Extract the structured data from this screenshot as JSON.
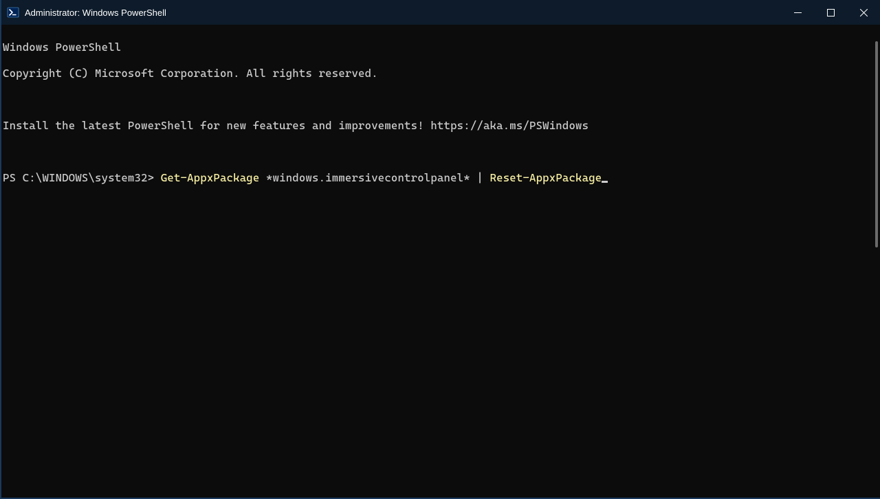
{
  "window": {
    "title": "Administrator: Windows PowerShell"
  },
  "terminal": {
    "banner_line1": "Windows PowerShell",
    "banner_line2": "Copyright (C) Microsoft Corporation. All rights reserved.",
    "install_msg": "Install the latest PowerShell for new features and improvements! https://aka.ms/PSWindows",
    "prompt": "PS C:\\WINDOWS\\system32> ",
    "command_segment1": "Get-AppxPackage",
    "command_args": " *windows.immersivecontrolpanel* ",
    "pipe": "| ",
    "command_segment2": "Reset-AppxPackage"
  },
  "colors": {
    "titlebar_bg": "#0d1b2a",
    "terminal_bg": "#0c0c0c",
    "text": "#cccccc",
    "command": "#f9f1a5"
  }
}
